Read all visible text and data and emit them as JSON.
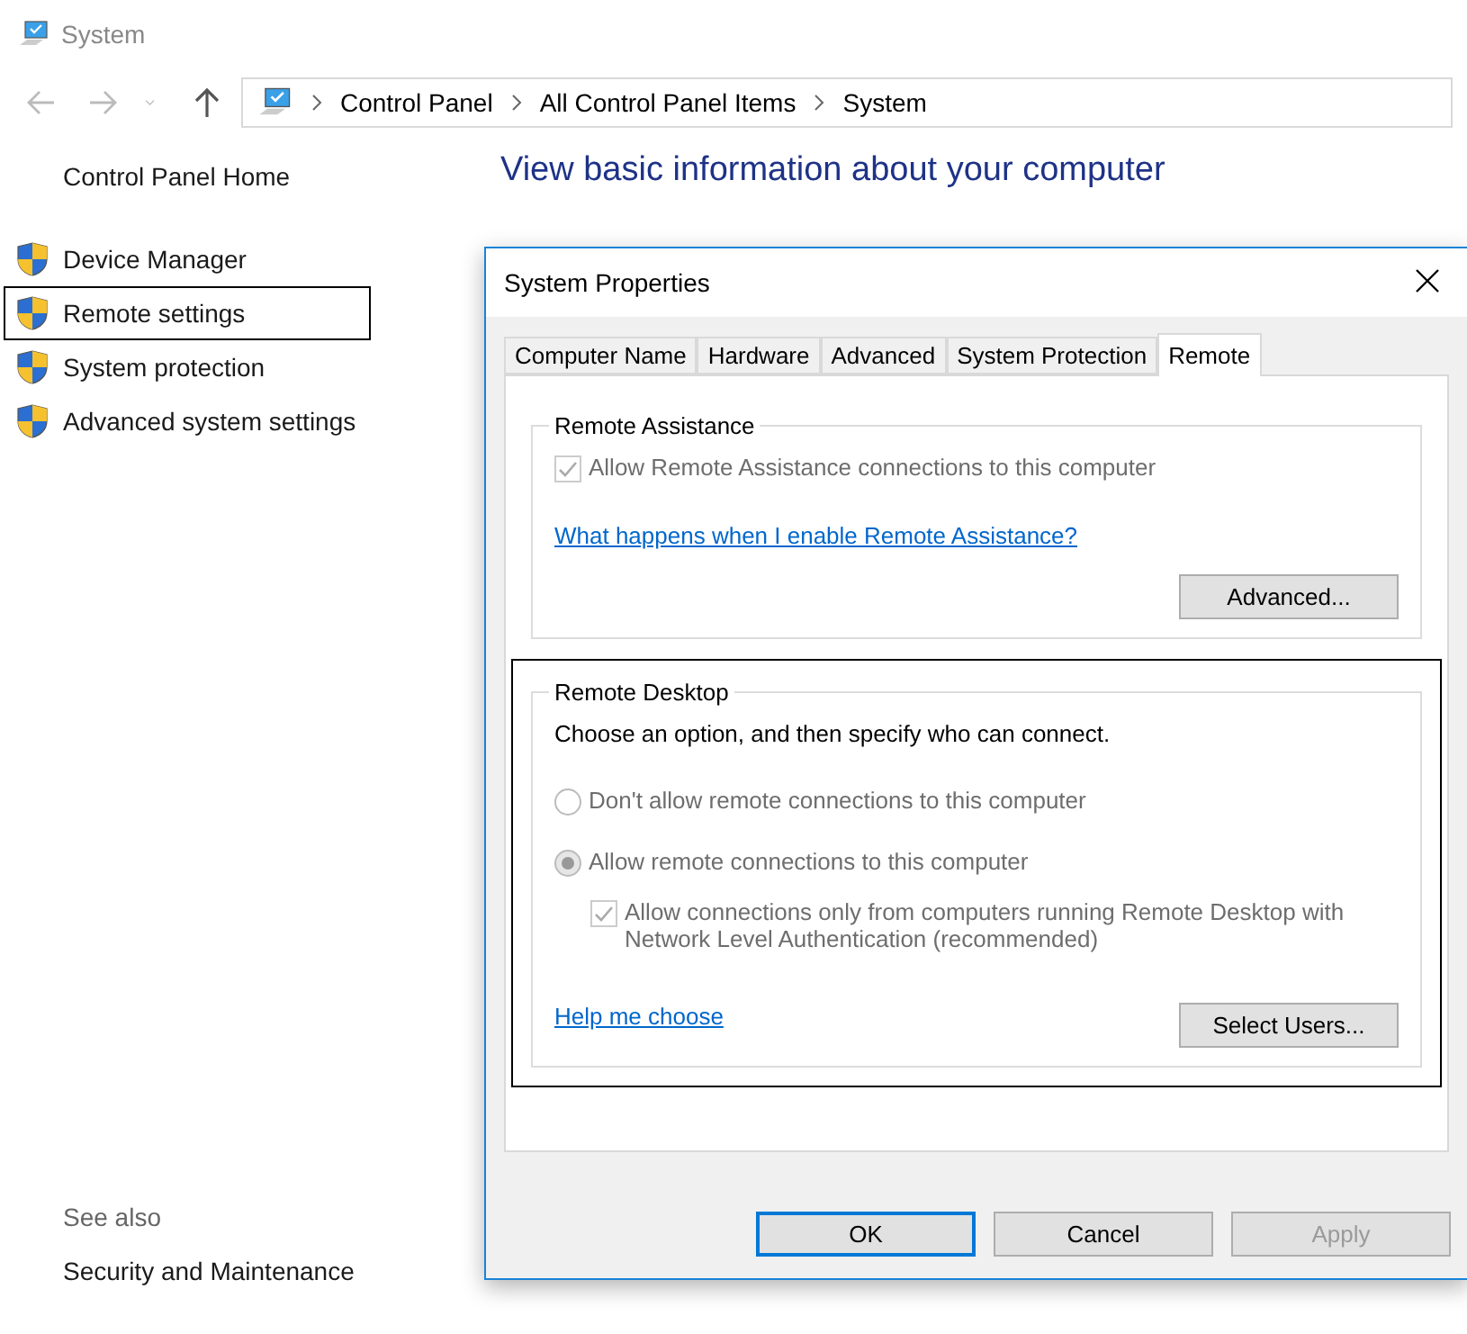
{
  "window": {
    "title": "System"
  },
  "breadcrumb": [
    "Control Panel",
    "All Control Panel Items",
    "System"
  ],
  "sidebar": {
    "home": "Control Panel Home",
    "items": [
      {
        "label": "Device Manager",
        "highlighted": false
      },
      {
        "label": "Remote settings",
        "highlighted": true
      },
      {
        "label": "System protection",
        "highlighted": false
      },
      {
        "label": "Advanced system settings",
        "highlighted": false
      }
    ],
    "see_also": {
      "heading": "See also",
      "links": [
        "Security and Maintenance"
      ]
    }
  },
  "main": {
    "heading": "View basic information about your computer"
  },
  "dialog": {
    "title": "System Properties",
    "tabs": [
      {
        "label": "Computer Name",
        "selected": false
      },
      {
        "label": "Hardware",
        "selected": false
      },
      {
        "label": "Advanced",
        "selected": false
      },
      {
        "label": "System Protection",
        "selected": false
      },
      {
        "label": "Remote",
        "selected": true
      }
    ],
    "remote_assistance": {
      "legend": "Remote Assistance",
      "checkbox": {
        "label": "Allow Remote Assistance connections to this computer",
        "checked": true,
        "disabled": true
      },
      "link": "What happens when I enable Remote Assistance?",
      "button": "Advanced..."
    },
    "remote_desktop": {
      "legend": "Remote Desktop",
      "highlighted": true,
      "intro": "Choose an option, and then specify who can connect.",
      "options": [
        {
          "label": "Don't allow remote connections to this computer",
          "selected": false
        },
        {
          "label": "Allow remote connections to this computer",
          "selected": true
        }
      ],
      "nla": {
        "label": "Allow connections only from computers running Remote Desktop with Network Level Authentication (recommended)",
        "checked": true
      },
      "link": "Help me choose",
      "button": "Select Users..."
    },
    "buttons": [
      {
        "label": "OK",
        "default": true,
        "disabled": false
      },
      {
        "label": "Cancel",
        "default": false,
        "disabled": false
      },
      {
        "label": "Apply",
        "default": false,
        "disabled": true
      }
    ]
  }
}
